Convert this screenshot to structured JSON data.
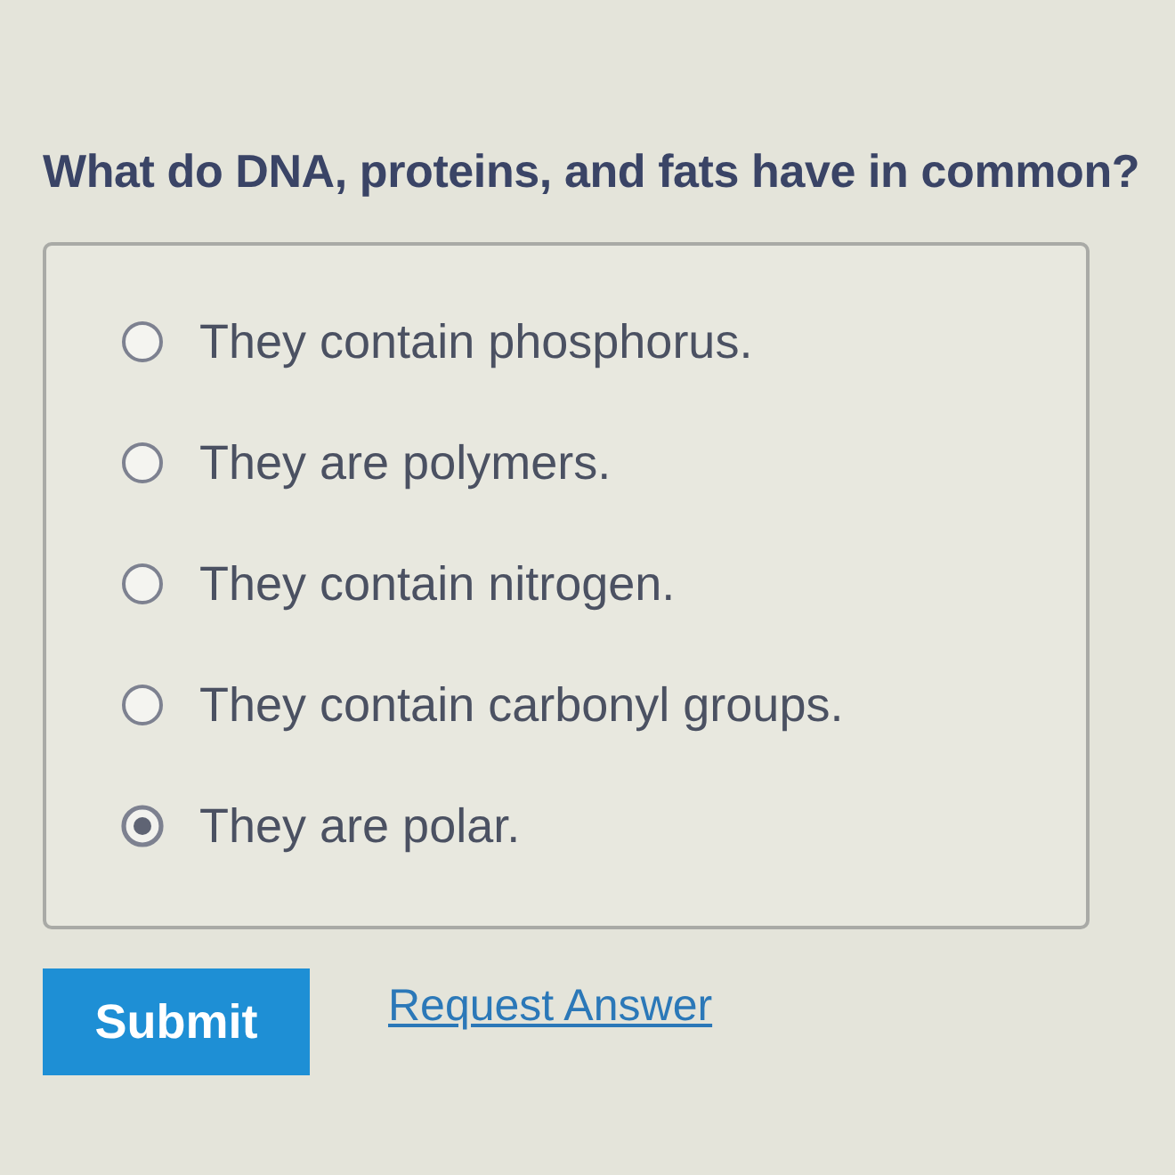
{
  "question": "What do DNA, proteins, and fats have in common?",
  "options": [
    {
      "label": "They contain phosphorus.",
      "selected": false
    },
    {
      "label": "They are polymers.",
      "selected": false
    },
    {
      "label": "They contain nitrogen.",
      "selected": false
    },
    {
      "label": "They contain carbonyl groups.",
      "selected": false
    },
    {
      "label": "They are polar.",
      "selected": true
    }
  ],
  "submit_button": "Submit",
  "request_link": "Request Answer"
}
